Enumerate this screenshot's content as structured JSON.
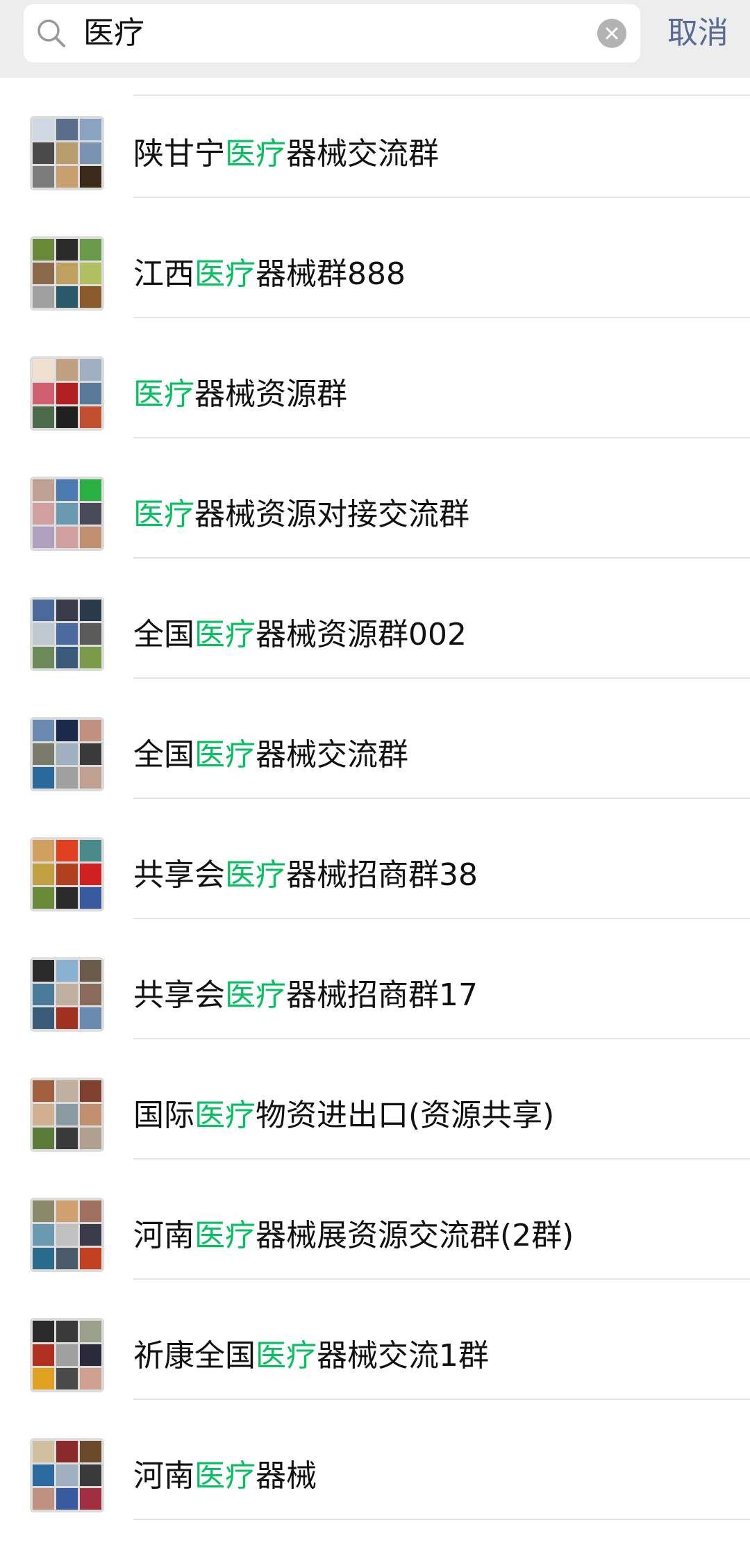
{
  "search": {
    "query": "医疗",
    "cancel_label": "取消"
  },
  "colors": {
    "highlight": "#07c160",
    "cancel": "#576b95"
  },
  "results": [
    {
      "pre": "陕甘宁",
      "hl": "医疗",
      "post": "器械交流群",
      "avatar": [
        "#cfd8e3",
        "#5a6e8c",
        "#8aa3c2",
        "#4a4a4a",
        "#b89c6e",
        "#7a93b0",
        "#7c7c7c",
        "#c8a070",
        "#3a2a1a"
      ]
    },
    {
      "pre": "江西",
      "hl": "医疗",
      "post": "器械群888",
      "avatar": [
        "#6a8a3a",
        "#2a2a2a",
        "#6a9a4a",
        "#8a6a4a",
        "#c0a060",
        "#b0c060",
        "#a0a0a0",
        "#2a5a6a",
        "#8a5a2a"
      ]
    },
    {
      "pre": "",
      "hl": "医疗",
      "post": "器械资源群",
      "avatar": [
        "#f0e0d0",
        "#c0a080",
        "#a0b0c0",
        "#d06070",
        "#b02020",
        "#5a7a9a",
        "#4a6a4a",
        "#202020",
        "#c05030"
      ]
    },
    {
      "pre": "",
      "hl": "医疗",
      "post": "器械资源对接交流群",
      "avatar": [
        "#c0a090",
        "#4a7ab0",
        "#2ab040",
        "#d0a0a0",
        "#6a9ab0",
        "#4a4a5a",
        "#b0a0c0",
        "#d0a0a0",
        "#c09070"
      ]
    },
    {
      "pre": "全国",
      "hl": "医疗",
      "post": "器械资源群002",
      "avatar": [
        "#4a6a9a",
        "#3a3a4a",
        "#2a3a4a",
        "#c0c8d0",
        "#4a6aa0",
        "#5a5a5a",
        "#6a8a5a",
        "#3a5a7a",
        "#7a9a4a"
      ]
    },
    {
      "pre": "全国",
      "hl": "医疗",
      "post": "器械交流群",
      "avatar": [
        "#6a8ab0",
        "#1a2a4a",
        "#c09080",
        "#7a7a6a",
        "#a0b0c0",
        "#3a3a3a",
        "#2a6a9a",
        "#a0a0a0",
        "#c0a090"
      ]
    },
    {
      "pre": "共享会",
      "hl": "医疗",
      "post": "器械招商群38",
      "avatar": [
        "#d0a060",
        "#e04020",
        "#4a8a8a",
        "#c0a040",
        "#b04020",
        "#d02020",
        "#6a8a3a",
        "#2a2a2a",
        "#3a5aa0"
      ]
    },
    {
      "pre": "共享会",
      "hl": "医疗",
      "post": "器械招商群17",
      "avatar": [
        "#2a2a2a",
        "#8ab0d0",
        "#6a5a4a",
        "#4a7a9a",
        "#c0b0a0",
        "#8a6a5a",
        "#3a5a7a",
        "#a03020",
        "#6a8ab0"
      ]
    },
    {
      "pre": "国际",
      "hl": "医疗",
      "post": "物资进出口(资源共享)",
      "avatar": [
        "#a06040",
        "#c0b0a0",
        "#804030",
        "#d0b090",
        "#8a9aa0",
        "#c09070",
        "#5a7a3a",
        "#3a3a3a",
        "#b0a090"
      ]
    },
    {
      "pre": "河南",
      "hl": "医疗",
      "post": "器械展资源交流群(2群)",
      "avatar": [
        "#8a8a6a",
        "#d0a070",
        "#a07060",
        "#6a9ab0",
        "#c0c0c0",
        "#3a3a4a",
        "#2a6a8a",
        "#4a5a6a",
        "#c04020"
      ]
    },
    {
      "pre": "祈康全国",
      "hl": "医疗",
      "post": "器械交流1群",
      "avatar": [
        "#2a2a2a",
        "#3a3a3a",
        "#9aa08a",
        "#b03020",
        "#a0a0a0",
        "#2a2a3a",
        "#e0a020",
        "#4a4a4a",
        "#d0a090"
      ]
    },
    {
      "pre": "河南",
      "hl": "医疗",
      "post": "器械",
      "avatar": [
        "#d0c0a0",
        "#8a2a2a",
        "#6a4a2a",
        "#2a6aa0",
        "#a0b0c0",
        "#3a3a3a",
        "#c09080",
        "#3a5aa0",
        "#a03040"
      ]
    }
  ]
}
